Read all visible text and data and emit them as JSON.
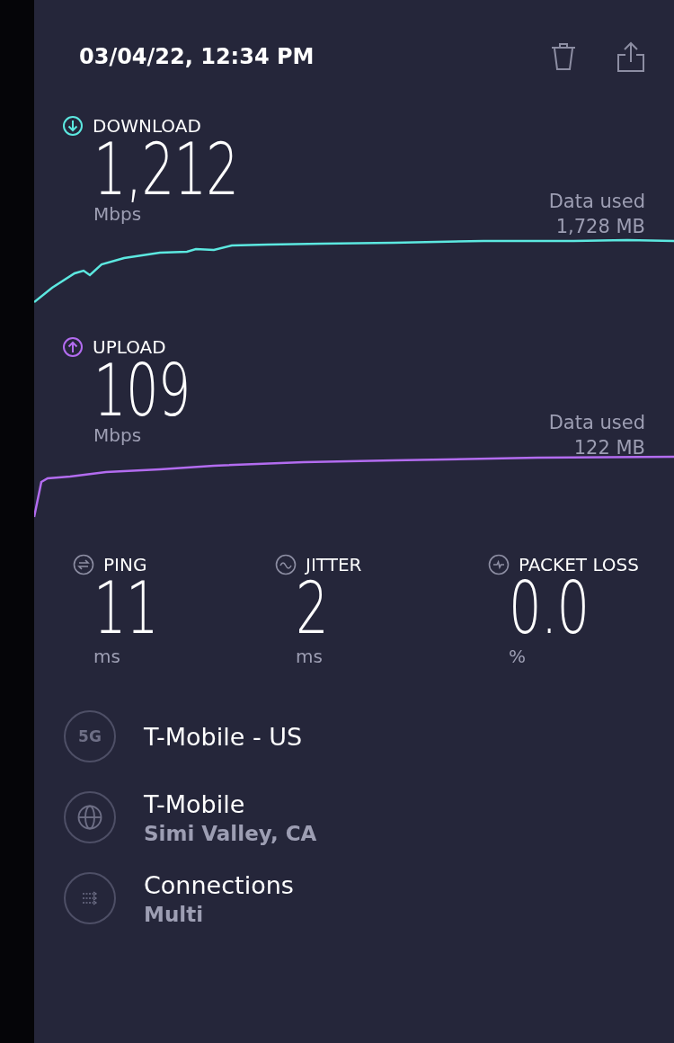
{
  "header": {
    "date": "03/04/22, 12:34 PM"
  },
  "tests": [
    {
      "kind": "download",
      "label": "DOWNLOAD",
      "value": "1,212",
      "unit": "Mbps",
      "data_label": "Data used",
      "data_value": "1,728 MB",
      "color": "#5ce8e0"
    },
    {
      "kind": "upload",
      "label": "UPLOAD",
      "value": "109",
      "unit": "Mbps",
      "data_label": "Data used",
      "data_value": "122 MB",
      "color": "#b36cf0"
    }
  ],
  "metrics": [
    {
      "kind": "ping",
      "label": "PING",
      "value": "11",
      "unit": "ms"
    },
    {
      "kind": "jitter",
      "label": "JITTER",
      "value": "2",
      "unit": "ms"
    },
    {
      "kind": "loss",
      "label": "PACKET LOSS",
      "value": "0.0",
      "unit": "%"
    }
  ],
  "info": [
    {
      "kind": "network",
      "badge": "5G",
      "title": "T-Mobile - US"
    },
    {
      "kind": "server",
      "title": "T-Mobile",
      "subtitle": "Simi Valley, CA"
    },
    {
      "kind": "connections",
      "title": "Connections",
      "subtitle": "Multi"
    }
  ]
}
